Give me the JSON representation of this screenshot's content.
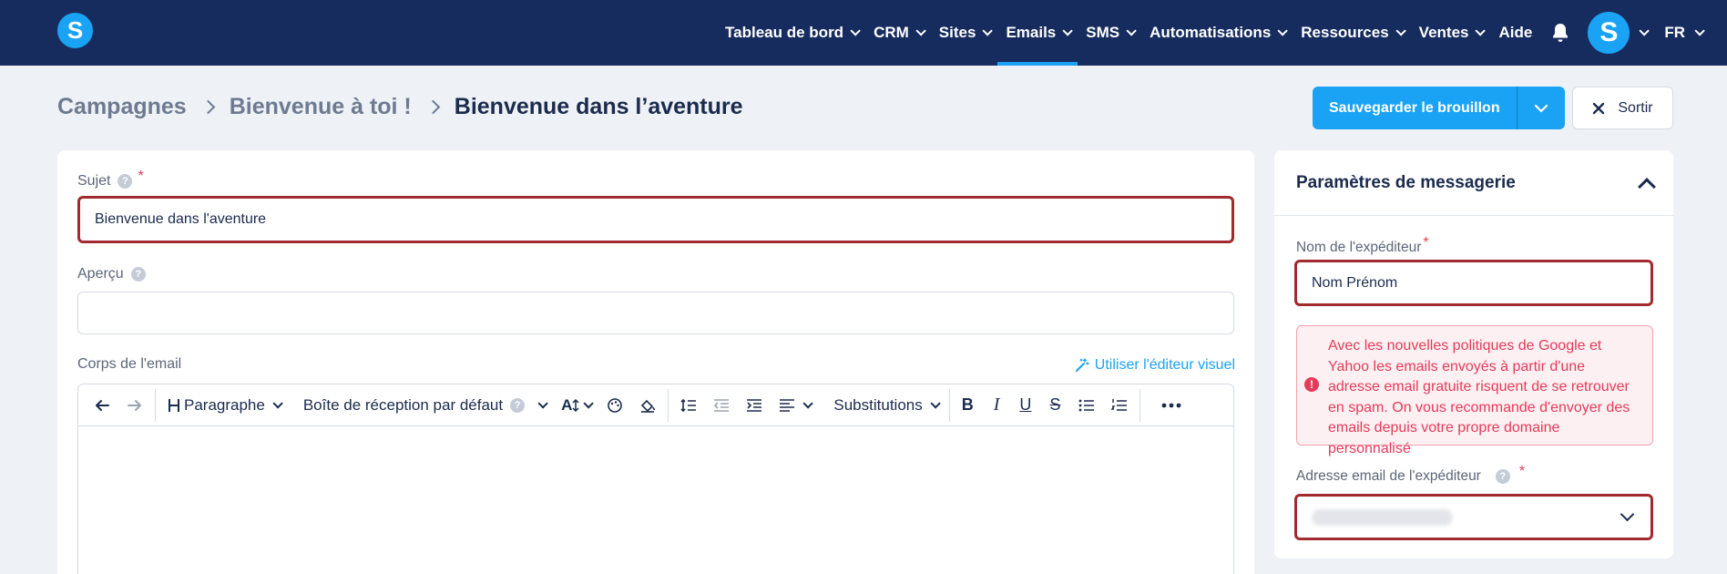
{
  "nav": {
    "logo_letter": "S",
    "items": [
      {
        "label": "Tableau de bord",
        "dropdown": true,
        "active": false
      },
      {
        "label": "CRM",
        "dropdown": true,
        "active": false
      },
      {
        "label": "Sites",
        "dropdown": true,
        "active": false
      },
      {
        "label": "Emails",
        "dropdown": true,
        "active": true
      },
      {
        "label": "SMS",
        "dropdown": true,
        "active": false
      },
      {
        "label": "Automatisations",
        "dropdown": true,
        "active": false
      },
      {
        "label": "Ressources",
        "dropdown": true,
        "active": false
      },
      {
        "label": "Ventes",
        "dropdown": true,
        "active": false
      },
      {
        "label": "Aide",
        "dropdown": false,
        "active": false
      }
    ],
    "bell_icon": "bell-icon",
    "avatar_letter": "S",
    "language": "FR"
  },
  "breadcrumb": {
    "items": [
      "Campagnes",
      "Bienvenue à toi !"
    ],
    "current": "Bienvenue dans l’aventure"
  },
  "actions": {
    "save_label": "Sauvegarder le brouillon",
    "exit_label": "Sortir"
  },
  "form": {
    "subject": {
      "label": "Sujet",
      "help": "?",
      "required": "*",
      "value": "Bienvenue dans l'aventure"
    },
    "preview": {
      "label": "Aperçu",
      "help": "?",
      "value": ""
    },
    "body": {
      "label": "Corps de l'email",
      "visual_editor_link": "Utiliser l'éditeur visuel"
    }
  },
  "toolbar": {
    "paragraph": "Paragraphe",
    "inbox": "Boîte de réception par défaut",
    "inbox_help": "?",
    "font_size": "A",
    "substitutions": "Substitutions",
    "bold": "B",
    "italic": "I",
    "underline": "U",
    "strike": "S"
  },
  "settings": {
    "title": "Paramètres de messagerie",
    "sender_name": {
      "label": "Nom de l'expéditeur",
      "required": "*",
      "value": "Nom Prénom"
    },
    "warning": "Avec les nouvelles politiques de Google et Yahoo les emails envoyés à partir d'une adresse email gratuite risquent de se retrouver en spam. On vous recommande d'envoyer des emails depuis votre propre domaine personnalisé",
    "warning_icon": "!",
    "sender_email": {
      "label": "Adresse email de l'expéditeur",
      "help": "?",
      "required": "*"
    }
  },
  "colors": {
    "nav_bg": "#172c5e",
    "accent": "#1aa3f5",
    "error_border": "#a12a2e",
    "warning_text": "#e43b5a"
  }
}
